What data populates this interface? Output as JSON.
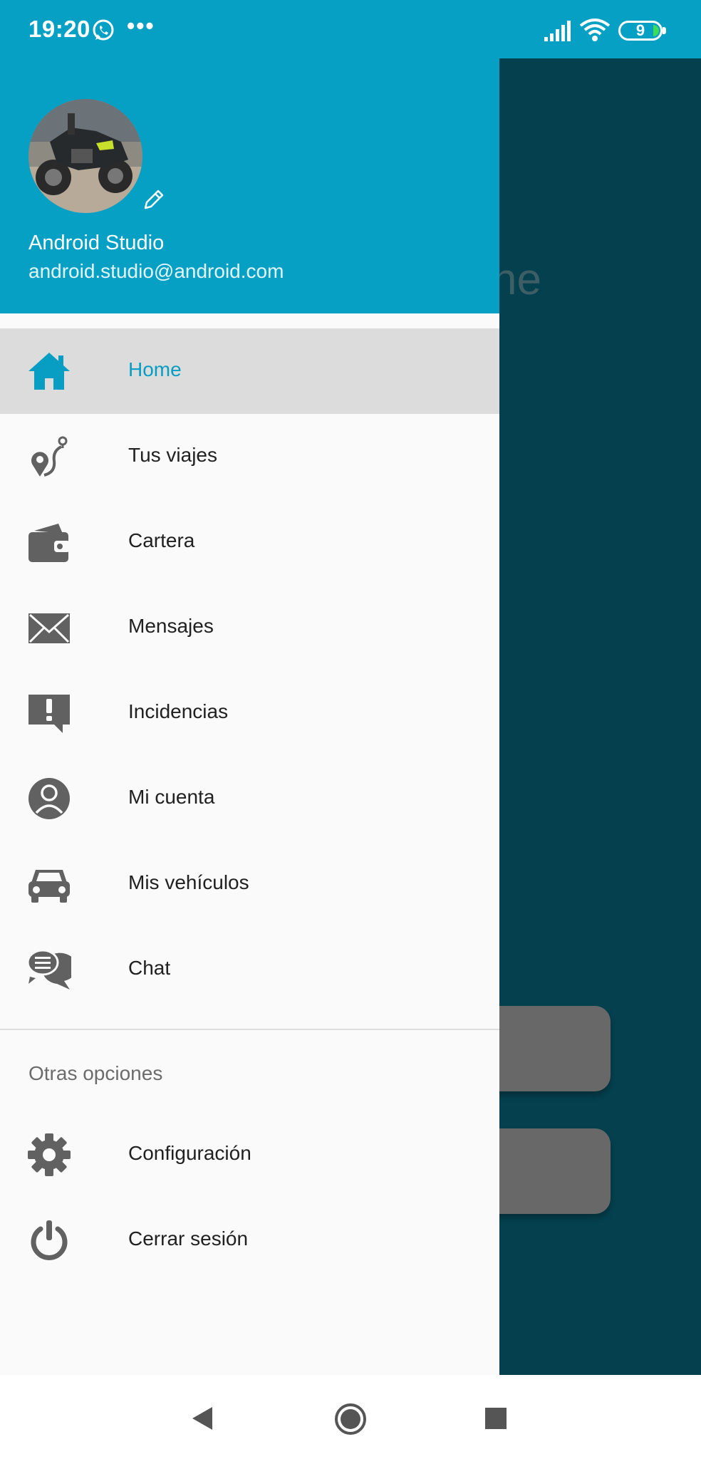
{
  "status_bar": {
    "time": "19:20",
    "dots": "•••",
    "battery_level": "9",
    "icons": [
      "whatsapp-icon",
      "signal-icon",
      "wifi-icon",
      "battery-icon"
    ]
  },
  "background_app": {
    "partial_text": "che\n?"
  },
  "drawer": {
    "header": {
      "user_name": "Android Studio",
      "user_email": "android.studio@android.com",
      "avatar": "motorcycle-photo",
      "edit_icon": "pencil-icon"
    },
    "items": [
      {
        "label": "Home",
        "icon": "home-icon",
        "active": true
      },
      {
        "label": "Tus viajes",
        "icon": "route-icon"
      },
      {
        "label": "Cartera",
        "icon": "wallet-icon"
      },
      {
        "label": "Mensajes",
        "icon": "mail-icon"
      },
      {
        "label": "Incidencias",
        "icon": "alert-comment-icon"
      },
      {
        "label": "Mi cuenta",
        "icon": "account-icon"
      },
      {
        "label": "Mis vehículos",
        "icon": "car-icon"
      },
      {
        "label": "Chat",
        "icon": "chat-icon"
      }
    ],
    "section_title": "Otras opciones",
    "other_items": [
      {
        "label": "Configuración",
        "icon": "gear-icon"
      },
      {
        "label": "Cerrar sesión",
        "icon": "power-icon"
      }
    ]
  },
  "colors": {
    "primary": "#06a0c5",
    "active_text": "#089ec3",
    "active_bg": "#dcdcdc",
    "scrim": "#04404e",
    "icon_gray": "#616161"
  }
}
